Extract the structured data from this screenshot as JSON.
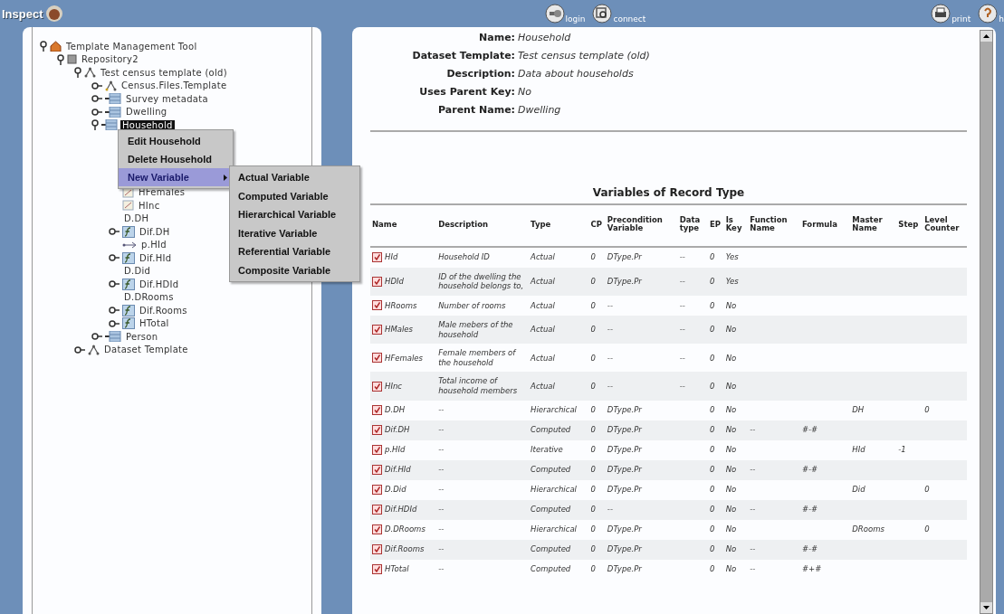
{
  "header": {
    "app_name": "Inspect",
    "toolbar": [
      {
        "kind": "login",
        "label": "login"
      },
      {
        "kind": "connect",
        "label": "connect"
      },
      {
        "kind": "print",
        "label": "print"
      },
      {
        "kind": "help",
        "label": "h"
      }
    ]
  },
  "tree": [
    {
      "label": "Template Management Tool",
      "kind": "tool",
      "expanded": true,
      "selected": false,
      "children": [
        {
          "label": "Repository2",
          "kind": "repository",
          "expanded": true,
          "selected": false,
          "children": [
            {
              "label": "Test census template (old)",
              "kind": "template",
              "expanded": true,
              "selected": false,
              "children": [
                {
                  "label": "Census.Files.Template",
                  "kind": "files",
                  "expanded": false,
                  "selected": false
                },
                {
                  "label": "Survey metadata",
                  "kind": "record",
                  "expanded": false,
                  "selected": false
                },
                {
                  "label": "Dwelling",
                  "kind": "record",
                  "expanded": false,
                  "selected": false
                },
                {
                  "label": "Household",
                  "kind": "record",
                  "expanded": true,
                  "selected": true,
                  "children": [
                    {
                      "label": "HFemales",
                      "kind": "actual",
                      "selected": false
                    },
                    {
                      "label": "HInc",
                      "kind": "actual",
                      "selected": false
                    },
                    {
                      "label": "D.DH",
                      "kind": "hierarchical",
                      "selected": false
                    },
                    {
                      "label": "Dif.DH",
                      "kind": "computed",
                      "expanded": false,
                      "selected": false
                    },
                    {
                      "label": "p.HId",
                      "kind": "iterative",
                      "selected": false
                    },
                    {
                      "label": "Dif.HId",
                      "kind": "computed",
                      "expanded": false,
                      "selected": false
                    },
                    {
                      "label": "D.Did",
                      "kind": "hierarchical",
                      "selected": false
                    },
                    {
                      "label": "Dif.HDId",
                      "kind": "computed",
                      "expanded": false,
                      "selected": false
                    },
                    {
                      "label": "D.DRooms",
                      "kind": "hierarchical",
                      "selected": false
                    },
                    {
                      "label": "Dif.Rooms",
                      "kind": "computed",
                      "expanded": false,
                      "selected": false
                    },
                    {
                      "label": "HTotal",
                      "kind": "computed",
                      "expanded": false,
                      "selected": false
                    }
                  ]
                },
                {
                  "label": "Person",
                  "kind": "record",
                  "expanded": false,
                  "selected": false
                }
              ]
            },
            {
              "label": "Dataset Template",
              "kind": "template",
              "expanded": false,
              "selected": false
            }
          ]
        }
      ]
    }
  ],
  "context_menu": {
    "items": [
      {
        "label": "Edit Household",
        "selected": false,
        "submenu": false
      },
      {
        "label": "Delete Household",
        "selected": false,
        "submenu": false
      },
      {
        "label": "New Variable",
        "selected": true,
        "submenu": true
      }
    ],
    "submenu_items": [
      "Actual Variable",
      "Computed Variable",
      "Hierarchical Variable",
      "Iterative Variable",
      "Referential Variable",
      "Composite Variable"
    ]
  },
  "details": [
    {
      "label": "Name:",
      "value": "Household"
    },
    {
      "label": "Dataset Template:",
      "value": "Test census template (old)"
    },
    {
      "label": "Description:",
      "value": "Data about households"
    },
    {
      "label": "Uses Parent Key:",
      "value": "No"
    },
    {
      "label": "Parent Name:",
      "value": "Dwelling"
    }
  ],
  "table": {
    "title": "Variables of Record Type",
    "columns": [
      "Name",
      "Description",
      "Type",
      "CP",
      "Precondition Variable",
      "Data type",
      "EP",
      "Is Key",
      "Function Name",
      "Formula",
      "Master Name",
      "Step",
      "Level Counter"
    ],
    "rows": [
      {
        "checked": true,
        "cells": [
          "HId",
          "Household ID",
          "Actual",
          "0",
          "DType.Pr",
          "--",
          "0",
          "Yes",
          null,
          null,
          null,
          null,
          null
        ]
      },
      {
        "checked": true,
        "cells": [
          "HDId",
          "ID of the dwelling the household belongs to,",
          "Actual",
          "0",
          "DType.Pr",
          "--",
          "0",
          "Yes",
          null,
          null,
          null,
          null,
          null
        ]
      },
      {
        "checked": true,
        "cells": [
          "HRooms",
          "Number of rooms",
          "Actual",
          "0",
          "--",
          "--",
          "0",
          "No",
          null,
          null,
          null,
          null,
          null
        ]
      },
      {
        "checked": true,
        "cells": [
          "HMales",
          "Male mebers of the household",
          "Actual",
          "0",
          "--",
          "--",
          "0",
          "No",
          null,
          null,
          null,
          null,
          null
        ]
      },
      {
        "checked": true,
        "cells": [
          "HFemales",
          "Female members of the household",
          "Actual",
          "0",
          "--",
          "--",
          "0",
          "No",
          null,
          null,
          null,
          null,
          null
        ]
      },
      {
        "checked": true,
        "cells": [
          "HInc",
          "Total income of household members",
          "Actual",
          "0",
          "--",
          "--",
          "0",
          "No",
          null,
          null,
          null,
          null,
          null
        ]
      },
      {
        "checked": true,
        "cells": [
          "D.DH",
          "--",
          "Hierarchical",
          "0",
          "DType.Pr",
          null,
          "0",
          "No",
          null,
          null,
          "DH",
          null,
          "0"
        ]
      },
      {
        "checked": true,
        "cells": [
          "Dif.DH",
          "--",
          "Computed",
          "0",
          "DType.Pr",
          null,
          "0",
          "No",
          "--",
          "#-#",
          null,
          null,
          null
        ]
      },
      {
        "checked": true,
        "cells": [
          "p.HId",
          "--",
          "Iterative",
          "0",
          "DType.Pr",
          null,
          "0",
          "No",
          null,
          null,
          "HId",
          "-1",
          null
        ]
      },
      {
        "checked": true,
        "cells": [
          "Dif.HId",
          "--",
          "Computed",
          "0",
          "DType.Pr",
          null,
          "0",
          "No",
          "--",
          "#-#",
          null,
          null,
          null
        ]
      },
      {
        "checked": true,
        "cells": [
          "D.Did",
          "--",
          "Hierarchical",
          "0",
          "DType.Pr",
          null,
          "0",
          "No",
          null,
          null,
          "Did",
          null,
          "0"
        ]
      },
      {
        "checked": true,
        "cells": [
          "Dif.HDId",
          "--",
          "Computed",
          "0",
          "--",
          null,
          "0",
          "No",
          "--",
          "#-#",
          null,
          null,
          null
        ]
      },
      {
        "checked": true,
        "cells": [
          "D.DRooms",
          "--",
          "Hierarchical",
          "0",
          "DType.Pr",
          null,
          "0",
          "No",
          null,
          null,
          "DRooms",
          null,
          "0"
        ]
      },
      {
        "checked": true,
        "cells": [
          "Dif.Rooms",
          "--",
          "Computed",
          "0",
          "DType.Pr",
          null,
          "0",
          "No",
          "--",
          "#-#",
          null,
          null,
          null
        ]
      },
      {
        "checked": true,
        "cells": [
          "HTotal",
          "--",
          "Computed",
          "0",
          "DType.Pr",
          null,
          "0",
          "No",
          "--",
          "#+#",
          null,
          null,
          null
        ]
      }
    ]
  }
}
